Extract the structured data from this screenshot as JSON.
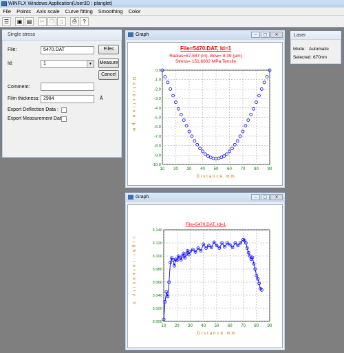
{
  "app": {
    "title": "WINFLX Windows Application(User3D : planglet)"
  },
  "menu": [
    "File",
    "Points",
    "Axis scale",
    "Curve fitting",
    "Smoothing",
    "Color"
  ],
  "toolbar": {
    "icons": [
      "list-icon",
      "open-folder-icon",
      "save-icon",
      "cut-icon",
      "copy-icon",
      "paste-icon",
      "print-icon",
      "help-icon"
    ],
    "glyphs": [
      "☰",
      "▣",
      "▤",
      "✂",
      "❐",
      "▯",
      "⎙",
      "?"
    ]
  },
  "single_stress": {
    "title": "Single stress",
    "file_label": "File:",
    "file_value": "5470.DAT",
    "files_button": "Files",
    "id_label": "Id:",
    "id_value": "1",
    "measure_button": "Measure",
    "cancel_button": "Cancel",
    "comment_label": "Comment:",
    "comment_value": "",
    "film_label": "Film thickness:",
    "film_value": "2984",
    "film_unit": "Å",
    "export_deflection": "Export Deflection Data :",
    "export_measurement": "Export Measurement Data :"
  },
  "laser": {
    "title": "Laser",
    "mode_label": "Mode:",
    "mode_value": "Automatic",
    "selected_label": "Selected:",
    "selected_value": "670nm"
  },
  "graph1": {
    "window_title": "Graph",
    "heading": "File=5470.DAT, Id=1",
    "line1": "Radius=87.587 (m), Bow=-9.39 (µm)",
    "line2": "Stress= 151.6002 MPa Tensile"
  },
  "graph2": {
    "window_title": "Graph",
    "heading": "File=5470.DAT, Id=1"
  },
  "chart_data": [
    {
      "type": "scatter",
      "title": "File=5470.DAT, Id=1",
      "xlabel": "Distance mm",
      "ylabel": "Deflection µm",
      "xlim": [
        10,
        90
      ],
      "ylim": [
        -10.0,
        0.0
      ],
      "xticks": [
        10,
        20,
        30,
        40,
        50,
        60,
        70,
        80,
        90
      ],
      "yticks": [
        "0.0",
        "-1.0",
        "-2.0",
        "-3.0",
        "-4.0",
        "-5.0",
        "-6.0",
        "-7.0",
        "-8.0",
        "-9.0",
        "-10.0"
      ],
      "grid": true,
      "color": "#0000ff",
      "x": [
        10,
        12,
        14,
        16,
        18,
        20,
        22,
        24,
        26,
        28,
        30,
        32,
        34,
        36,
        38,
        40,
        42,
        44,
        46,
        48,
        50,
        52,
        54,
        56,
        58,
        60,
        62,
        64,
        66,
        68,
        70,
        72,
        74,
        76,
        78,
        80,
        82,
        84,
        86,
        88,
        90
      ],
      "y": [
        0.0,
        -0.7,
        -1.3,
        -2.0,
        -2.7,
        -3.4,
        -4.1,
        -4.7,
        -5.3,
        -5.9,
        -6.5,
        -7.0,
        -7.5,
        -7.9,
        -8.3,
        -8.6,
        -8.9,
        -9.1,
        -9.25,
        -9.35,
        -9.39,
        -9.35,
        -9.25,
        -9.1,
        -8.9,
        -8.6,
        -8.3,
        -7.9,
        -7.5,
        -7.0,
        -6.5,
        -5.9,
        -5.3,
        -4.7,
        -4.1,
        -3.4,
        -2.7,
        -2.0,
        -1.3,
        -0.7,
        0.0
      ]
    },
    {
      "type": "line",
      "title": "File=5470.DAT, Id=1",
      "xlabel": "Distance mm",
      "ylabel": "Light intensity V",
      "xlim": [
        10,
        90
      ],
      "ylim": [
        3.0,
        3.14
      ],
      "xticks": [
        10,
        20,
        30,
        40,
        50,
        60,
        70,
        80,
        90
      ],
      "yticks": [
        "3.000",
        "3.020",
        "3.040",
        "3.060",
        "3.080",
        "3.100",
        "3.120",
        "3.140"
      ],
      "grid": true,
      "color": "#0000ff",
      "x": [
        10,
        11,
        12,
        13,
        14,
        15,
        16,
        17,
        18,
        19,
        20,
        21,
        22,
        23,
        24,
        25,
        26,
        27,
        28,
        29,
        30,
        32,
        34,
        36,
        38,
        40,
        42,
        44,
        46,
        48,
        50,
        52,
        54,
        56,
        58,
        60,
        62,
        64,
        66,
        68,
        70,
        71,
        72,
        73,
        74,
        75,
        76,
        77,
        78,
        79,
        80,
        81,
        82,
        83,
        84
      ],
      "y": [
        3.003,
        3.03,
        3.045,
        3.038,
        3.06,
        3.09,
        3.097,
        3.094,
        3.085,
        3.095,
        3.093,
        3.1,
        3.097,
        3.094,
        3.1,
        3.104,
        3.097,
        3.103,
        3.108,
        3.102,
        3.107,
        3.11,
        3.106,
        3.112,
        3.108,
        3.118,
        3.112,
        3.116,
        3.113,
        3.121,
        3.116,
        3.112,
        3.12,
        3.114,
        3.12,
        3.117,
        3.113,
        3.12,
        3.116,
        3.12,
        3.125,
        3.124,
        3.12,
        3.112,
        3.105,
        3.1,
        3.095,
        3.098,
        3.088,
        3.08,
        3.07,
        3.065,
        3.058,
        3.05,
        3.048
      ]
    }
  ]
}
